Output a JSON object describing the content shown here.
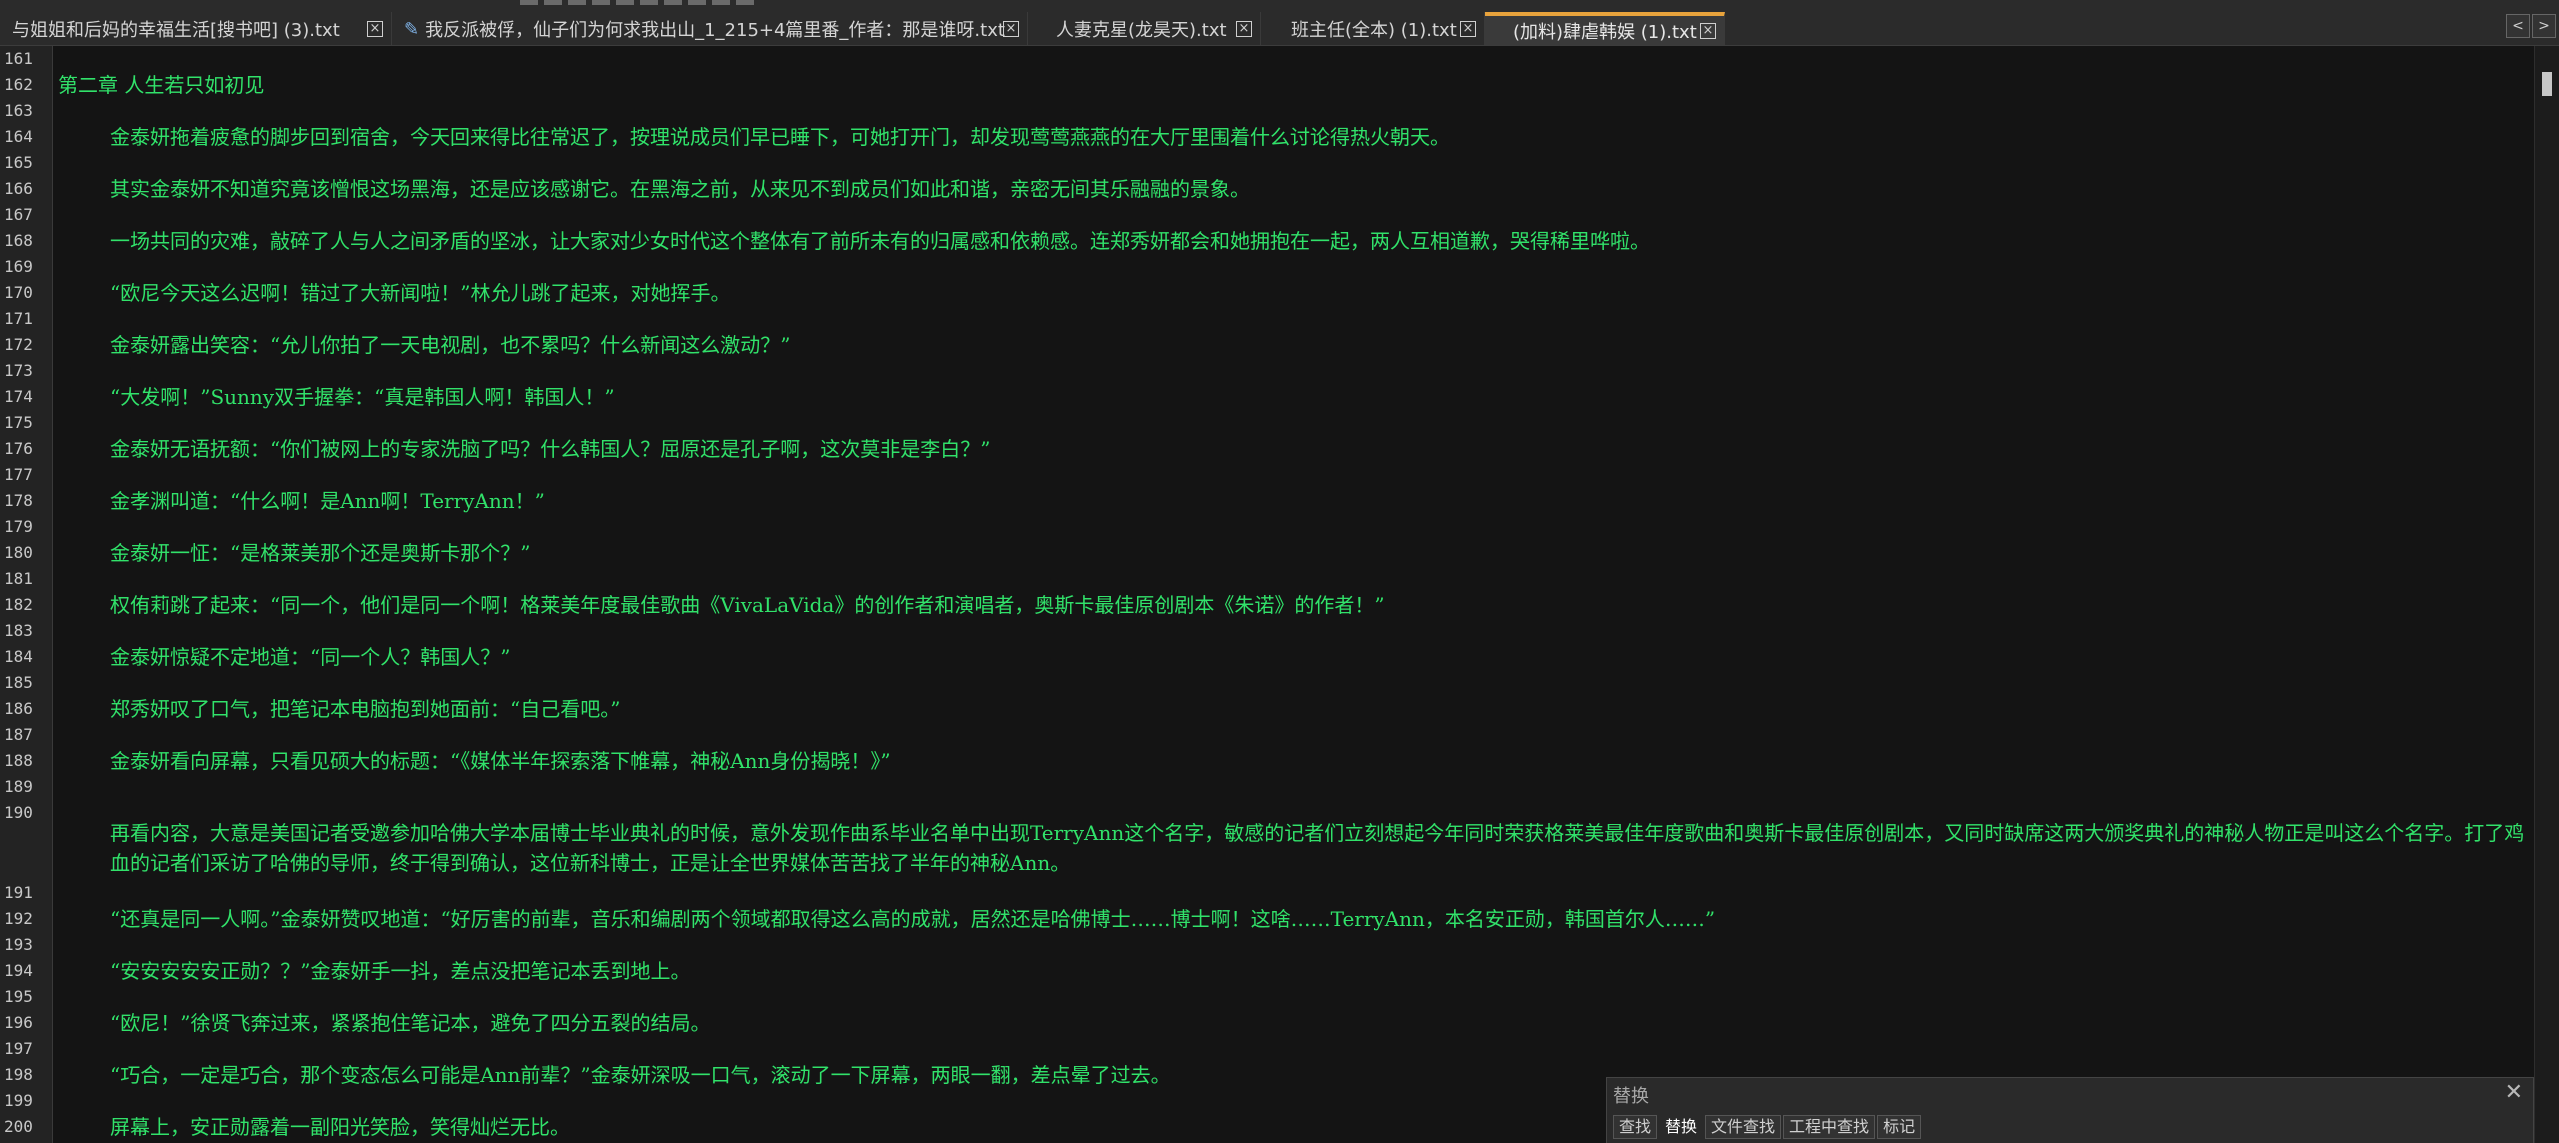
{
  "tabs": [
    {
      "label": "与姐姐和后妈的幸福生活[搜书吧] (3).txt",
      "close": "×",
      "modified": false,
      "active": false
    },
    {
      "label": "我反派被俘，仙子们为何求我出山_1_215+4篇里番_作者：那是谁呀.txt",
      "close": "×",
      "modified": true,
      "active": false
    },
    {
      "label": "人妻克星(龙昊天).txt",
      "close": "×",
      "modified": false,
      "active": false
    },
    {
      "label": "班主任(全本) (1).txt",
      "close": "×",
      "modified": false,
      "active": false
    },
    {
      "label": "(加料)肆虐韩娱 (1).txt",
      "close": "×",
      "modified": false,
      "active": true
    }
  ],
  "tab_nav": {
    "prev": "<",
    "next": ">"
  },
  "editor": {
    "text_color": "#31e26a",
    "lines": [
      {
        "n": "161",
        "text": ""
      },
      {
        "n": "162",
        "text": "第二章 人生若只如初见"
      },
      {
        "n": "163",
        "text": ""
      },
      {
        "n": "164",
        "text": "金泰妍拖着疲惫的脚步回到宿舍，今天回来得比往常迟了，按理说成员们早已睡下，可她打开门，却发现莺莺燕燕的在大厅里围着什么讨论得热火朝天。"
      },
      {
        "n": "165",
        "text": ""
      },
      {
        "n": "166",
        "text": "其实金泰妍不知道究竟该憎恨这场黑海，还是应该感谢它。在黑海之前，从来见不到成员们如此和谐，亲密无间其乐融融的景象。"
      },
      {
        "n": "167",
        "text": ""
      },
      {
        "n": "168",
        "text": "一场共同的灾难，敲碎了人与人之间矛盾的坚冰，让大家对少女时代这个整体有了前所未有的归属感和依赖感。连郑秀妍都会和她拥抱在一起，两人互相道歉，哭得稀里哗啦。"
      },
      {
        "n": "169",
        "text": ""
      },
      {
        "n": "170",
        "text": "“欧尼今天这么迟啊！错过了大新闻啦！”林允儿跳了起来，对她挥手。"
      },
      {
        "n": "171",
        "text": ""
      },
      {
        "n": "172",
        "text": "金泰妍露出笑容：“允儿你拍了一天电视剧，也不累吗？什么新闻这么激动？”"
      },
      {
        "n": "173",
        "text": ""
      },
      {
        "n": "174",
        "text": "“大发啊！”Sunny双手握拳：“真是韩国人啊！韩国人！”"
      },
      {
        "n": "175",
        "text": ""
      },
      {
        "n": "176",
        "text": "金泰妍无语抚额：“你们被网上的专家洗脑了吗？什么韩国人？屈原还是孔子啊，这次莫非是李白？”"
      },
      {
        "n": "177",
        "text": ""
      },
      {
        "n": "178",
        "text": "金孝渊叫道：“什么啊！是Ann啊！TerryAnn！”"
      },
      {
        "n": "179",
        "text": ""
      },
      {
        "n": "180",
        "text": "金泰妍一怔：“是格莱美那个还是奥斯卡那个？”"
      },
      {
        "n": "181",
        "text": ""
      },
      {
        "n": "182",
        "text": "权侑莉跳了起来：“同一个，他们是同一个啊！格莱美年度最佳歌曲《VivaLaVida》的创作者和演唱者，奥斯卡最佳原创剧本《朱诺》的作者！”"
      },
      {
        "n": "183",
        "text": ""
      },
      {
        "n": "184",
        "text": "金泰妍惊疑不定地道：“同一个人？韩国人？”"
      },
      {
        "n": "185",
        "text": ""
      },
      {
        "n": "186",
        "text": "郑秀妍叹了口气，把笔记本电脑抱到她面前：“自己看吧。”"
      },
      {
        "n": "187",
        "text": ""
      },
      {
        "n": "188",
        "text": "金泰妍看向屏幕，只看见硕大的标题：“《媒体半年探索落下帷幕，神秘Ann身份揭晓！》”"
      },
      {
        "n": "189",
        "text": ""
      },
      {
        "n": "190",
        "text": ""
      },
      {
        "n": "",
        "text": "再看内容，大意是美国记者受邀参加哈佛大学本届博士毕业典礼的时候，意外发现作曲系毕业名单中出现TerryAnn这个名字，敏感的记者们立刻想起今年同时荣获格莱美最佳年度歌曲和奥斯卡最佳原创剧本，又同时缺席这两大颁奖典礼的神秘人物正是叫这么个名字。打了鸡血的记者们采访了哈佛的导师，终于得到确认，这位新科博士，正是让全世界媒体苦苦找了半年的神秘Ann。"
      },
      {
        "n": "191",
        "text": ""
      },
      {
        "n": "192",
        "text": "“还真是同一人啊。”金泰妍赞叹地道：“好厉害的前辈，音乐和编剧两个领域都取得这么高的成就，居然还是哈佛博士……博士啊！这啥……TerryAnn，本名安正勋，韩国首尔人……”"
      },
      {
        "n": "193",
        "text": ""
      },
      {
        "n": "194",
        "text": "“安安安安安正勋？？”金泰妍手一抖，差点没把笔记本丢到地上。"
      },
      {
        "n": "195",
        "text": ""
      },
      {
        "n": "196",
        "text": "“欧尼！”徐贤飞奔过来，紧紧抱住笔记本，避免了四分五裂的结局。"
      },
      {
        "n": "197",
        "text": ""
      },
      {
        "n": "198",
        "text": "“巧合，一定是巧合，那个变态怎么可能是Ann前辈？”金泰妍深吸一口气，滚动了一下屏幕，两眼一翻，差点晕了过去。"
      },
      {
        "n": "199",
        "text": ""
      },
      {
        "n": "200",
        "text": "屏幕上，安正勋露着一副阳光笑脸，笑得灿烂无比。"
      }
    ]
  },
  "find_panel": {
    "title": "替换",
    "close": "✕",
    "tabs": [
      "查找",
      "替换",
      "文件查找",
      "工程中查找",
      "标记"
    ],
    "active_tab": "替换"
  }
}
